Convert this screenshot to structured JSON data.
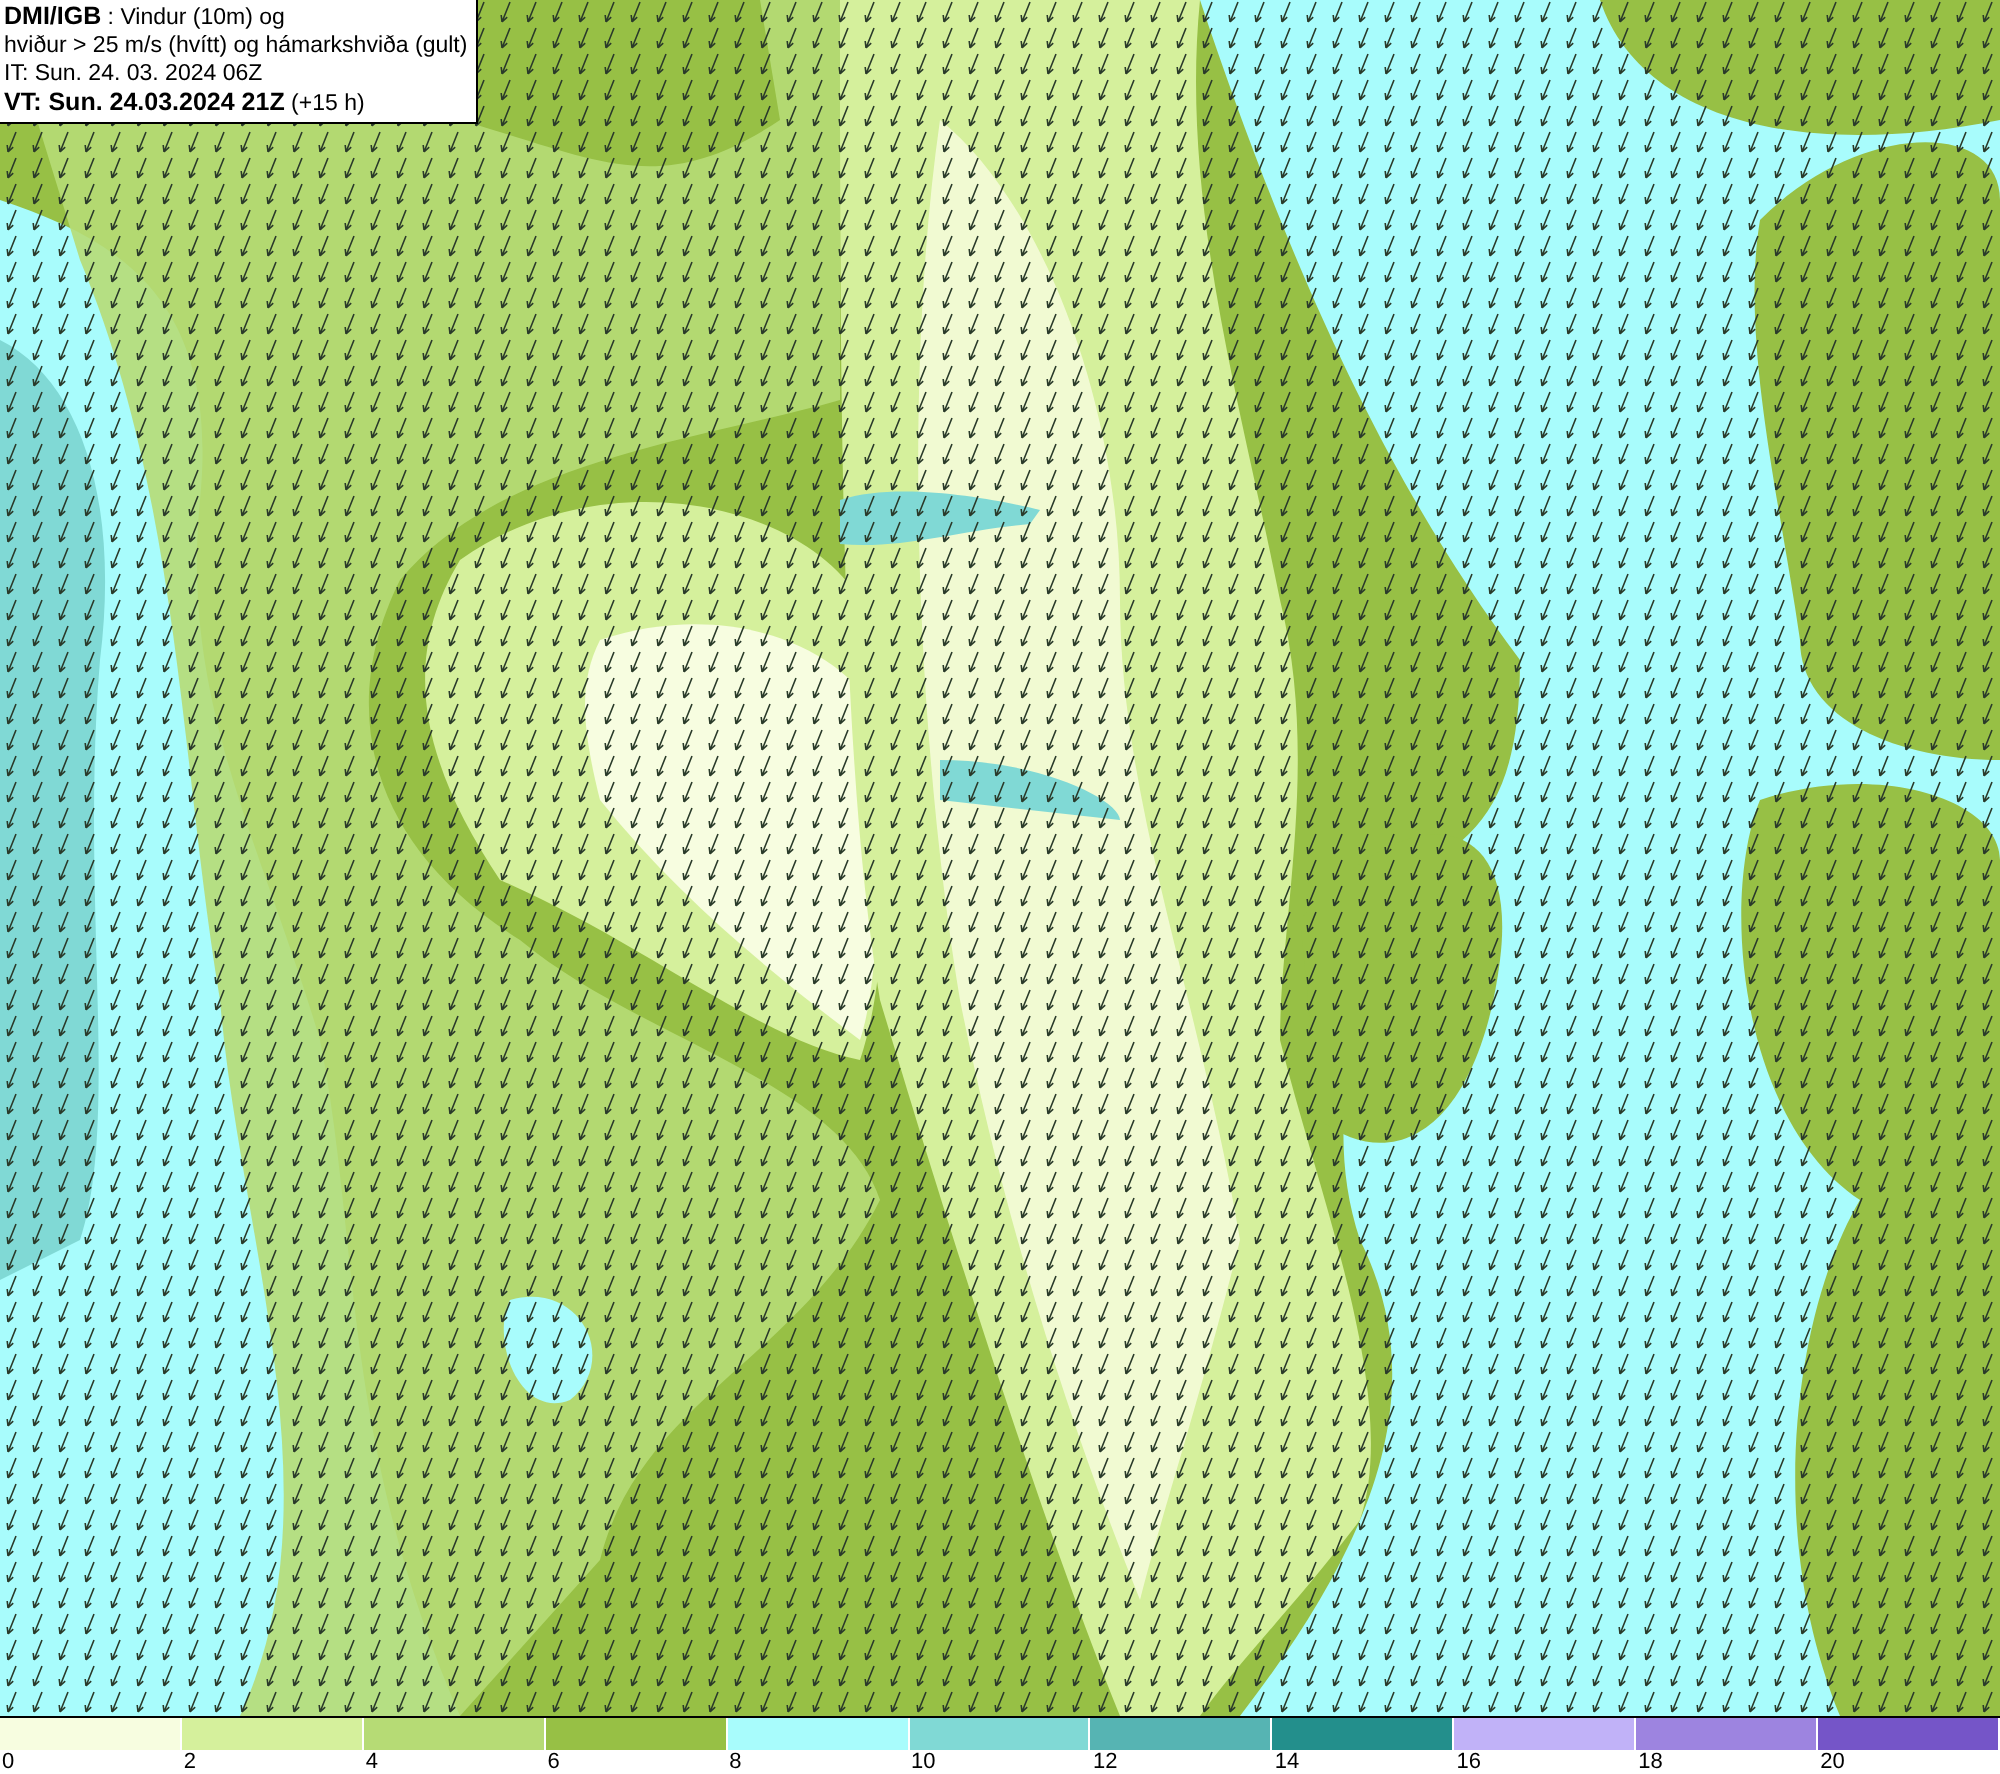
{
  "title_box": {
    "lines": [
      "**DMI/IGB** : Vindur (10m) og",
      "hviður > 25 m/s (hvítt) og hámarkshviða (gult)",
      "IT: Sun. 24. 03. 2024 06Z",
      "**VT: Sun. 24.03.2024 21Z** (+15 h)"
    ]
  },
  "legend": [
    {
      "label": "0",
      "color": "#f7fde0"
    },
    {
      "label": "2",
      "color": "#d5f09c"
    },
    {
      "label": "4",
      "color": "#b6db75"
    },
    {
      "label": "6",
      "color": "#97c045"
    },
    {
      "label": "8",
      "color": "#a8fcfc"
    },
    {
      "label": "10",
      "color": "#80d9d5"
    },
    {
      "label": "12",
      "color": "#56b4b3"
    },
    {
      "label": "14",
      "color": "#238f8c"
    },
    {
      "label": "16",
      "color": "#c1b2f8"
    },
    {
      "label": "18",
      "color": "#9d84e0"
    },
    {
      "label": "20",
      "color": "#7555c8"
    }
  ]
}
